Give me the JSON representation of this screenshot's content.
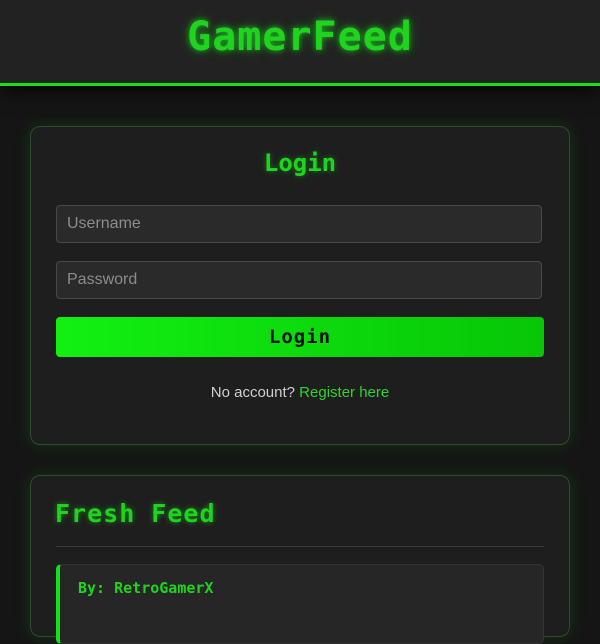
{
  "header": {
    "brand": "GamerFeed"
  },
  "login": {
    "title": "Login",
    "username_placeholder": "Username",
    "password_placeholder": "Password",
    "button_label": "Login",
    "register_prompt": "No account?",
    "register_link": "Register here"
  },
  "feed": {
    "title": "Fresh Feed",
    "posts": [
      {
        "author_line": "By: RetroGamerX"
      }
    ]
  },
  "colors": {
    "accent": "#1ed41e",
    "background": "#151515",
    "card": "#1e1e1e",
    "header": "#222222"
  }
}
